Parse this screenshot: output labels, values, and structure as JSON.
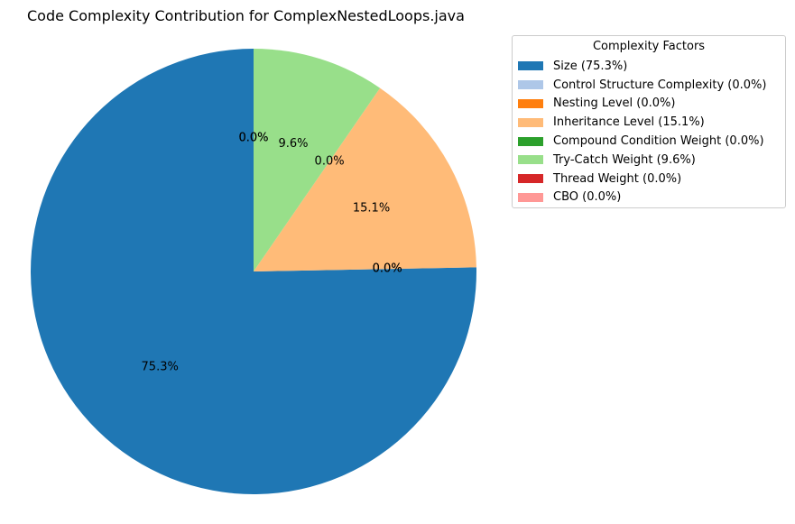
{
  "chart_data": {
    "type": "pie",
    "title": "Code Complexity Contribution for ComplexNestedLoops.java",
    "start_angle": 90,
    "direction": "counterclockwise",
    "slices": [
      {
        "label": "Size",
        "value": 75.3,
        "pct_label": "75.3%",
        "color": "#1f77b4"
      },
      {
        "label": "Control Structure Complexity",
        "value": 0.0,
        "pct_label": "0.0%",
        "color": "#aec7e8"
      },
      {
        "label": "Nesting Level",
        "value": 0.0,
        "pct_label": "0.0%",
        "color": "#ff7f0e"
      },
      {
        "label": "Inheritance Level",
        "value": 15.1,
        "pct_label": "15.1%",
        "color": "#ffbb78"
      },
      {
        "label": "Compound Condition Weight",
        "value": 0.0,
        "pct_label": "0.0%",
        "color": "#2ca02c"
      },
      {
        "label": "Try-Catch Weight",
        "value": 9.6,
        "pct_label": "9.6%",
        "color": "#98df8a"
      },
      {
        "label": "Thread Weight",
        "value": 0.0,
        "pct_label": "0.0%",
        "color": "#d62728"
      },
      {
        "label": "CBO",
        "value": 0.0,
        "pct_label": "0.0%",
        "color": "#ff9896"
      }
    ],
    "legend": {
      "title": "Complexity Factors",
      "placement": "right, outside",
      "entries": [
        "Size (75.3%)",
        "Control Structure Complexity (0.0%)",
        "Nesting Level (0.0%)",
        "Inheritance Level (15.1%)",
        "Compound Condition Weight (0.0%)",
        "Try-Catch Weight (9.6%)",
        "Thread Weight (0.0%)",
        "CBO (0.0%)"
      ]
    }
  }
}
